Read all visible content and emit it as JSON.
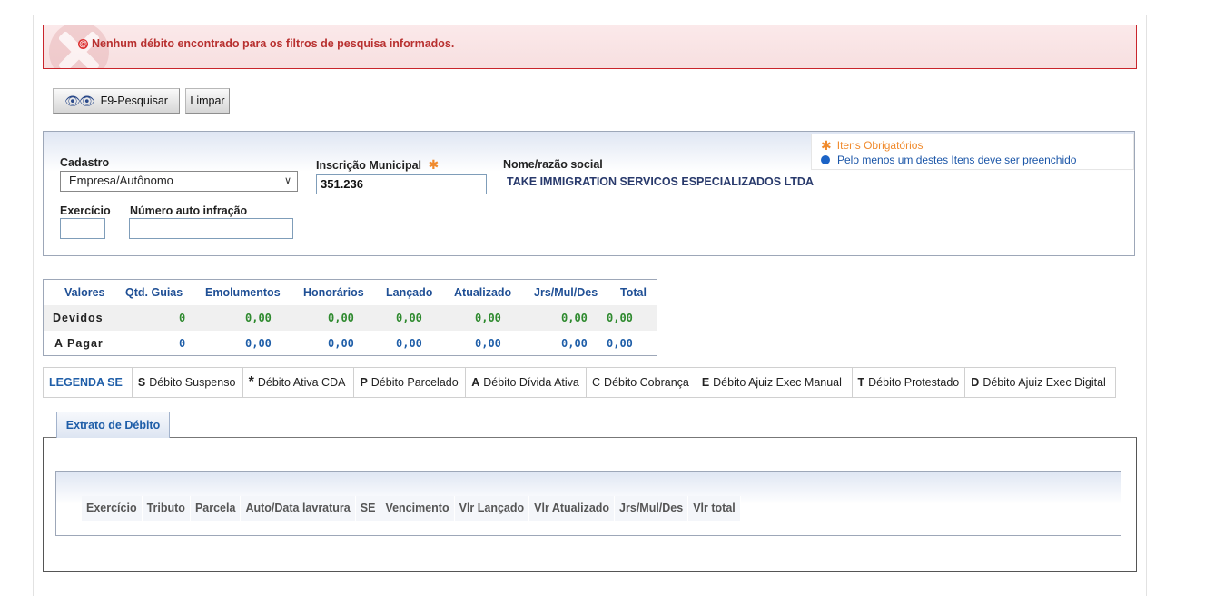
{
  "error": {
    "message": "Nenhum débito encontrado para os filtros de pesquisa informados."
  },
  "toolbar": {
    "search_label": "F9-Pesquisar",
    "clear_label": "Limpar"
  },
  "legend": {
    "required": "Itens Obrigatórios",
    "at_least_one": "Pelo menos um destes Itens deve ser preenchido"
  },
  "form": {
    "cadastro_label": "Cadastro",
    "cadastro_value": "Empresa/Autônomo",
    "inscricao_label": "Inscrição Municipal",
    "inscricao_value": "351.236",
    "nome_label": "Nome/razão social",
    "nome_value": "TAKE IMMIGRATION SERVICOS ESPECIALIZADOS LTDA",
    "exercicio_label": "Exercício",
    "exercicio_value": "",
    "auto_label": "Número auto infração",
    "auto_value": ""
  },
  "summary": {
    "headers": [
      "Valores",
      "Qtd. Guias",
      "Emolumentos",
      "Honorários",
      "Lançado",
      "Atualizado",
      "Jrs/Mul/Des",
      "Total"
    ],
    "devidos": [
      "Devidos",
      "0",
      "0,00",
      "0,00",
      "0,00",
      "0,00",
      "0,00",
      "0,00"
    ],
    "a_pagar": [
      "A Pagar",
      "0",
      "0,00",
      "0,00",
      "0,00",
      "0,00",
      "0,00",
      "0,00"
    ]
  },
  "se_legend": {
    "title": "LEGENDA SE",
    "items": [
      {
        "code": "S",
        "label": "Débito Suspenso"
      },
      {
        "code": "*",
        "label": "Débito Ativa CDA"
      },
      {
        "code": "P",
        "label": "Débito Parcelado"
      },
      {
        "code": "A",
        "label": "Débito Dívida Ativa"
      },
      {
        "code": "C",
        "label": "Débito Cobrança"
      },
      {
        "code": "E",
        "label": "Débito Ajuiz Exec Manual"
      },
      {
        "code": "T",
        "label": "Débito Protestado"
      },
      {
        "code": "D",
        "label": "Débito Ajuiz Exec Digital"
      }
    ]
  },
  "tab": {
    "label": "Extrato de Débito"
  },
  "grid": {
    "columns": [
      "Exercício",
      "Tributo",
      "Parcela",
      "Auto/Data lavratura",
      "SE",
      "Vencimento",
      "Vlr Lançado",
      "Vlr Atualizado",
      "Jrs/Mul/Des",
      "Vlr total"
    ]
  }
}
